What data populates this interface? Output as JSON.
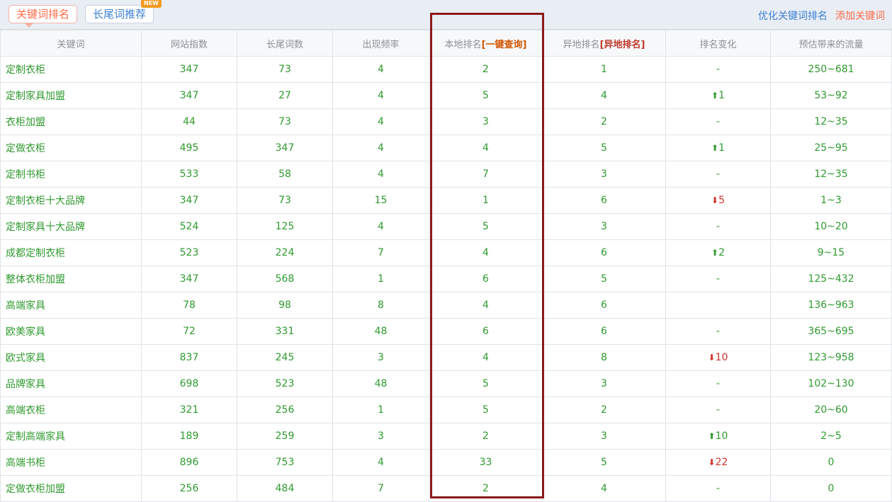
{
  "tabs": [
    {
      "label": "关键词排名",
      "active": true
    },
    {
      "label": "长尾词推荐",
      "badge": "NEW"
    }
  ],
  "links": {
    "optimize": "优化关键词排名",
    "add": "添加关键词"
  },
  "table": {
    "headers": {
      "keyword": "关键词",
      "site_index": "网站指数",
      "longtail": "长尾词数",
      "frequency": "出现频率",
      "local_rank": "本地排名",
      "local_action": "[一键查询]",
      "remote_rank": "异地排名",
      "remote_action": "[异地排名]",
      "rank_change": "排名变化",
      "traffic": "预估带来的流量"
    },
    "rows": [
      {
        "keyword": "定制衣柜",
        "site_index": "347",
        "longtail": "73",
        "frequency": "4",
        "local_rank": "2",
        "remote_rank": "1",
        "change_dir": "none",
        "change": "-",
        "traffic": "250~681"
      },
      {
        "keyword": "定制家具加盟",
        "site_index": "347",
        "longtail": "27",
        "frequency": "4",
        "local_rank": "5",
        "remote_rank": "4",
        "change_dir": "up",
        "change": "1",
        "traffic": "53~92"
      },
      {
        "keyword": "衣柜加盟",
        "site_index": "44",
        "longtail": "73",
        "frequency": "4",
        "local_rank": "3",
        "remote_rank": "2",
        "change_dir": "none",
        "change": "-",
        "traffic": "12~35"
      },
      {
        "keyword": "定做衣柜",
        "site_index": "495",
        "longtail": "347",
        "frequency": "4",
        "local_rank": "4",
        "remote_rank": "5",
        "change_dir": "up",
        "change": "1",
        "traffic": "25~95"
      },
      {
        "keyword": "定制书柜",
        "site_index": "533",
        "longtail": "58",
        "frequency": "4",
        "local_rank": "7",
        "remote_rank": "3",
        "change_dir": "none",
        "change": "-",
        "traffic": "12~35"
      },
      {
        "keyword": "定制衣柜十大品牌",
        "site_index": "347",
        "longtail": "73",
        "frequency": "15",
        "local_rank": "1",
        "remote_rank": "6",
        "change_dir": "down",
        "change": "5",
        "traffic": "1~3"
      },
      {
        "keyword": "定制家具十大品牌",
        "site_index": "524",
        "longtail": "125",
        "frequency": "4",
        "local_rank": "5",
        "remote_rank": "3",
        "change_dir": "none",
        "change": "-",
        "traffic": "10~20"
      },
      {
        "keyword": "成都定制衣柜",
        "site_index": "523",
        "longtail": "224",
        "frequency": "7",
        "local_rank": "4",
        "remote_rank": "6",
        "change_dir": "up",
        "change": "2",
        "traffic": "9~15"
      },
      {
        "keyword": "整体衣柜加盟",
        "site_index": "347",
        "longtail": "568",
        "frequency": "1",
        "local_rank": "6",
        "remote_rank": "5",
        "change_dir": "none",
        "change": "-",
        "traffic": "125~432"
      },
      {
        "keyword": "高端家具",
        "site_index": "78",
        "longtail": "98",
        "frequency": "8",
        "local_rank": "4",
        "remote_rank": "6",
        "change_dir": "none",
        "change": "",
        "traffic": "136~963"
      },
      {
        "keyword": "欧美家具",
        "site_index": "72",
        "longtail": "331",
        "frequency": "48",
        "local_rank": "6",
        "remote_rank": "6",
        "change_dir": "none",
        "change": "-",
        "traffic": "365~695"
      },
      {
        "keyword": "欧式家具",
        "site_index": "837",
        "longtail": "245",
        "frequency": "3",
        "local_rank": "4",
        "remote_rank": "8",
        "change_dir": "down",
        "change": "10",
        "traffic": "123~958"
      },
      {
        "keyword": "品牌家具",
        "site_index": "698",
        "longtail": "523",
        "frequency": "48",
        "local_rank": "5",
        "remote_rank": "3",
        "change_dir": "none",
        "change": "-",
        "traffic": "102~130"
      },
      {
        "keyword": "高端衣柜",
        "site_index": "321",
        "longtail": "256",
        "frequency": "1",
        "local_rank": "5",
        "remote_rank": "2",
        "change_dir": "none",
        "change": "-",
        "traffic": "20~60"
      },
      {
        "keyword": "定制高端家具",
        "site_index": "189",
        "longtail": "259",
        "frequency": "3",
        "local_rank": "2",
        "remote_rank": "3",
        "change_dir": "up",
        "change": "10",
        "traffic": "2~5"
      },
      {
        "keyword": "高端书柜",
        "site_index": "896",
        "longtail": "753",
        "frequency": "4",
        "local_rank": "33",
        "remote_rank": "5",
        "change_dir": "down",
        "change": "22",
        "traffic": "0"
      },
      {
        "keyword": "定做衣柜加盟",
        "site_index": "256",
        "longtail": "484",
        "frequency": "7",
        "local_rank": "2",
        "remote_rank": "4",
        "change_dir": "none",
        "change": "-",
        "traffic": "0"
      }
    ]
  },
  "colors": {
    "up": "#2f9a2f",
    "down": "#d0302a",
    "highlight_box": "#8b1a1a",
    "active_tab": "#ff6a46",
    "link": "#3c7fd4"
  },
  "icons": {
    "up": "arrow-up-icon",
    "down": "arrow-down-icon"
  }
}
